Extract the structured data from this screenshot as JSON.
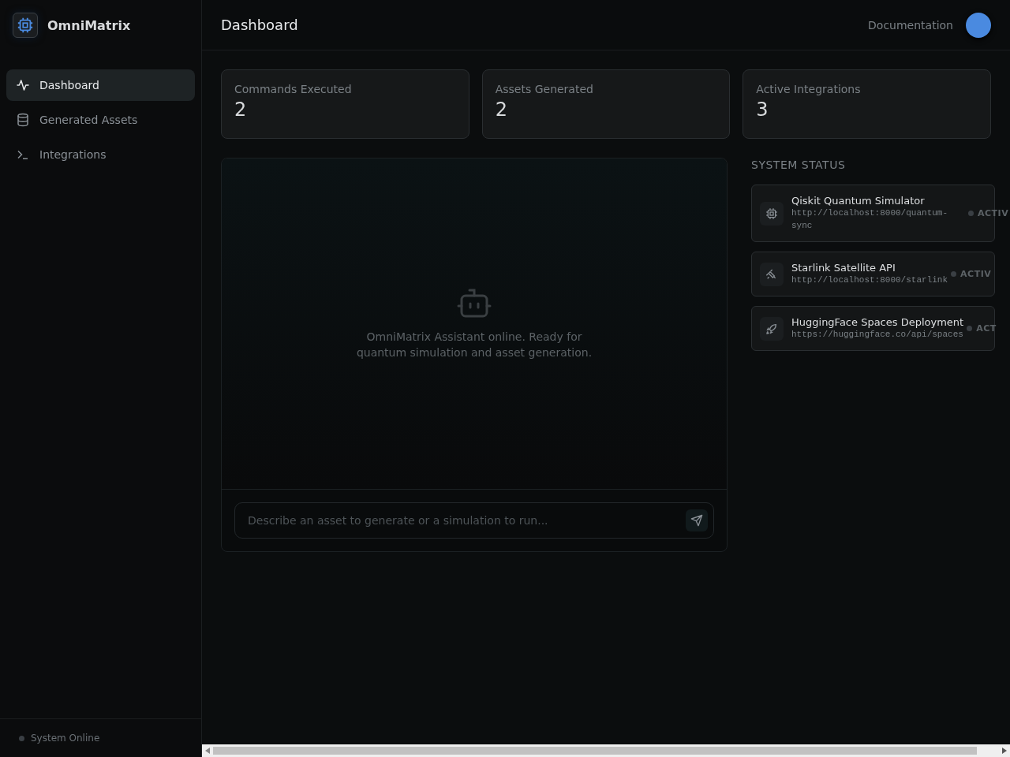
{
  "brand": {
    "name": "OmniMatrix"
  },
  "sidebar": {
    "items": [
      {
        "label": "Dashboard",
        "selected": true
      },
      {
        "label": "Generated Assets",
        "selected": false
      },
      {
        "label": "Integrations",
        "selected": false
      }
    ],
    "footer": "System Online"
  },
  "header": {
    "title": "Dashboard",
    "link": "Documentation"
  },
  "stats": [
    {
      "label": "Commands Executed",
      "value": "2"
    },
    {
      "label": "Assets Generated",
      "value": "2"
    },
    {
      "label": "Active Integrations",
      "value": "3"
    }
  ],
  "chat": {
    "message": "OmniMatrix Assistant online. Ready for quantum simulation and asset generation.",
    "placeholder": "Describe an asset to generate or a simulation to run..."
  },
  "system_status": {
    "title": "SYSTEM STATUS",
    "items": [
      {
        "name": "Qiskit Quantum Simulator",
        "url": "http://localhost:8000/quantum-sync",
        "status": "ACTIV"
      },
      {
        "name": "Starlink Satellite API",
        "url": "http://localhost:8000/starlink",
        "status": "ACTIV"
      },
      {
        "name": "HuggingFace Spaces Deployment",
        "url": "https://huggingface.co/api/spaces",
        "status": "ACT"
      }
    ]
  }
}
